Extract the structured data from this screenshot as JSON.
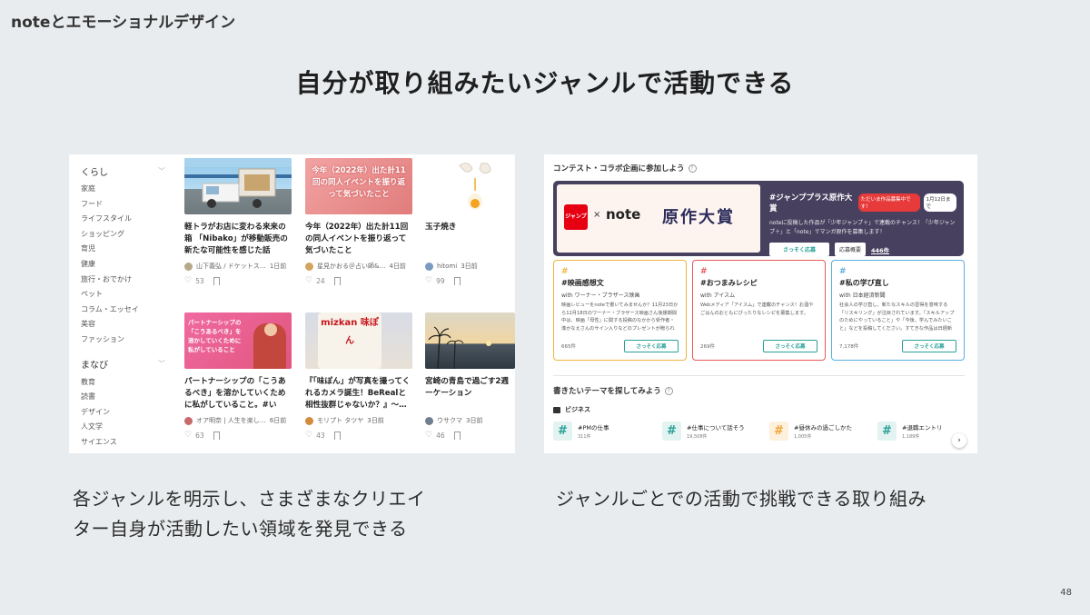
{
  "header": {
    "title": "noteとエモーショナルデザイン"
  },
  "slide_title": "自分が取り組みたいジャンルで活動できる",
  "left": {
    "sidebar": {
      "group1": "くらし",
      "group1_items": [
        "家庭",
        "フード",
        "ライフスタイル",
        "ショッピング",
        "育児",
        "健康",
        "旅行・おでかけ",
        "ペット",
        "コラム・エッセイ",
        "美容",
        "ファッション"
      ],
      "group2": "まなび",
      "group2_items": [
        "教育",
        "読書",
        "デザイン",
        "人文学",
        "サイエンス"
      ]
    },
    "cards": [
      {
        "title": "軽トラがお店に変わる来来の箱 「Nibako」が移動販売の新たな可能性を感じた話",
        "author": "山下義弘 / ドケットス…",
        "date": "1日前",
        "likes": "53"
      },
      {
        "title": "今年（2022年）出た計11回の同人イベントを振り返って気づいたこと",
        "author": "星見かおる＠占い師&…",
        "date": "4日前",
        "likes": "24",
        "thumb_text": "今年（2022年）出た計11回の同人イベントを振り返って気づいたこと"
      },
      {
        "title": "玉子焼き",
        "author": "hitomi",
        "date": "3日前",
        "likes": "99"
      },
      {
        "title": "パートナーシップの「こうあるべき」を溶かしていくために私がしていること。#いい…",
        "author": "オア明奈 | 人生を楽し…",
        "date": "6日前",
        "likes": "63",
        "thumb_text": "パートナーシップの「こうあるべき」を溶かしていくために私がしていること"
      },
      {
        "title": "『「味ぽん」が写真を撮ってくれるカメラ誕生！BeRealと相性抜群じゃないか？』〜…",
        "author": "モリプト タツヤ",
        "date": "3日前",
        "likes": "43",
        "thumb_text": "mizkan 味ぽん"
      },
      {
        "title": "宮崎の青島で過ごす2週ーケーション",
        "author": "ウサクマ",
        "date": "3日前",
        "likes": "46"
      }
    ]
  },
  "right": {
    "contest_heading": "コンテスト・コラボ企画に参加しよう",
    "banner": {
      "logo_text": "ジャンプ",
      "note_text": "note",
      "big_text": "原作大賞",
      "title": "#ジャンププラス原作大賞",
      "badge": "ただいま作品募集中です！",
      "date": "1月12日まで",
      "desc": "noteに投稿した作品が「少年ジャンプ＋」で連載のチャンス！「少年ジャンプ＋」と「note」でマンガ原作を募集します！",
      "apply": "さっそく応募",
      "guide": "応募概要",
      "count": "446件"
    },
    "contests": [
      {
        "title": "#映画感想文",
        "with": "with ワーナー・ブラザース映画",
        "desc": "映画レビューをnoteで書いてみませんか？11月23日から12月18日のワーナー・ブラザース映画さん後援期間中は、映画「母性」に関する投稿のなかから受作者・湊かなえさんのサイン入りなどのプレゼントが贈られます！",
        "count": "665件",
        "button": "さっそく応募"
      },
      {
        "title": "#おつまみレシピ",
        "with": "with アイスム",
        "desc": "Webメディア「アイスム」で連載のチャンス！お酒やごはんのおともにぴったりなレシピを募集します。",
        "count": "269件",
        "button": "さっそく応募"
      },
      {
        "title": "#私の学び直し",
        "with": "with 日本経済新聞",
        "desc": "社会人の学び直し、新たなスキルの習得を意味する「リスキリング」が注目されています。「スキルアップのためにやっていること」や「今後、学んでみたいこと」などを投稿してください。すてきな作品は日経新聞が運営する「日経COMEMO」や「日経電子版」に掲載される可能性があります。",
        "count": "7,178件",
        "button": "さっそく応募"
      }
    ],
    "theme_heading": "書きたいテーマを探してみよう",
    "category": "ビジネス",
    "themes": [
      {
        "label": "#PMの仕事",
        "count": "311件"
      },
      {
        "label": "#仕事について話そう",
        "count": "19,508件"
      },
      {
        "label": "#昼休みの過ごしかた",
        "count": "1,005件"
      },
      {
        "label": "#退職エントリ",
        "count": "1,189件"
      }
    ]
  },
  "captions": {
    "left_line1": "各ジャンルを明示し、さまざまなクリエイ",
    "left_line2": "ター自身が活動したい領域を発見できる",
    "right": "ジャンルごとでの活動で挑戦できる取り組み"
  },
  "page_number": "48",
  "colors": {
    "contest1": "#f0b43c",
    "contest2": "#e95757",
    "contest3": "#5aaee0",
    "banner_bg": "#47405f",
    "accent": "#2aa198"
  }
}
